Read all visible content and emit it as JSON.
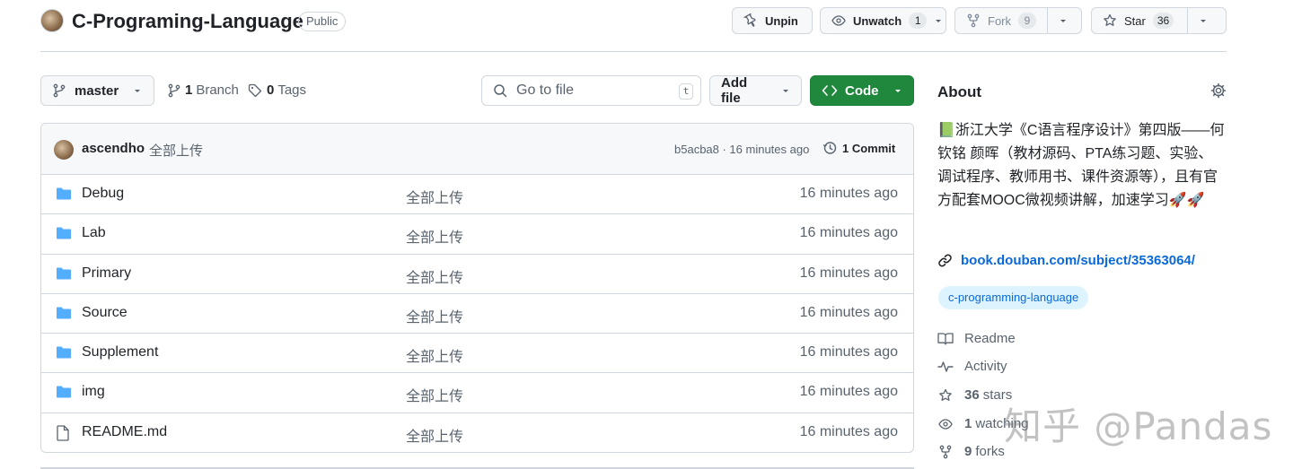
{
  "header": {
    "repo_name": "C-Programing-Language",
    "visibility": "Public",
    "unpin_label": "Unpin",
    "unwatch_label": "Unwatch",
    "watch_count": "1",
    "fork_label": "Fork",
    "fork_count": "9",
    "star_label": "Star",
    "star_count": "36"
  },
  "toolbar": {
    "branch_name": "master",
    "branch_count": "1",
    "branch_label": "Branch",
    "tag_count": "0",
    "tag_label": "Tags",
    "goto_placeholder": "Go to file",
    "goto_shortcut": "t",
    "add_file_label": "Add file",
    "code_label": "Code"
  },
  "commit": {
    "author": "ascendho",
    "message": "全部上传",
    "meta": "b5acba8 · 16 minutes ago",
    "commit_count": "1 Commit"
  },
  "files": [
    {
      "name": "Debug",
      "type": "folder",
      "message": "全部上传",
      "time": "16 minutes ago"
    },
    {
      "name": "Lab",
      "type": "folder",
      "message": "全部上传",
      "time": "16 minutes ago"
    },
    {
      "name": "Primary",
      "type": "folder",
      "message": "全部上传",
      "time": "16 minutes ago"
    },
    {
      "name": "Source",
      "type": "folder",
      "message": "全部上传",
      "time": "16 minutes ago"
    },
    {
      "name": "Supplement",
      "type": "folder",
      "message": "全部上传",
      "time": "16 minutes ago"
    },
    {
      "name": "img",
      "type": "folder",
      "message": "全部上传",
      "time": "16 minutes ago"
    },
    {
      "name": "README.md",
      "type": "file",
      "message": "全部上传",
      "time": "16 minutes ago"
    }
  ],
  "about": {
    "title": "About",
    "description": "📗浙江大学《C语言程序设计》第四版——何钦铭 颜晖（教材源码、PTA练习题、实验、调试程序、教师用书、课件资源等），且有官方配套MOOC微视频讲解，加速学习🚀🚀",
    "link": "book.douban.com/subject/35363064/",
    "topic": "c-programming-language",
    "readme_label": "Readme",
    "activity_label": "Activity",
    "stars_count": "36",
    "stars_label": "stars",
    "watching_count": "1",
    "watching_label": "watching",
    "forks_count": "9",
    "forks_label": "forks"
  },
  "watermark": "知乎 @Pandas",
  "colors": {
    "accent_green": "#1f883d",
    "link_blue": "#0969da",
    "folder_blue": "#54aeff",
    "topic_bg": "#ddf4ff"
  }
}
